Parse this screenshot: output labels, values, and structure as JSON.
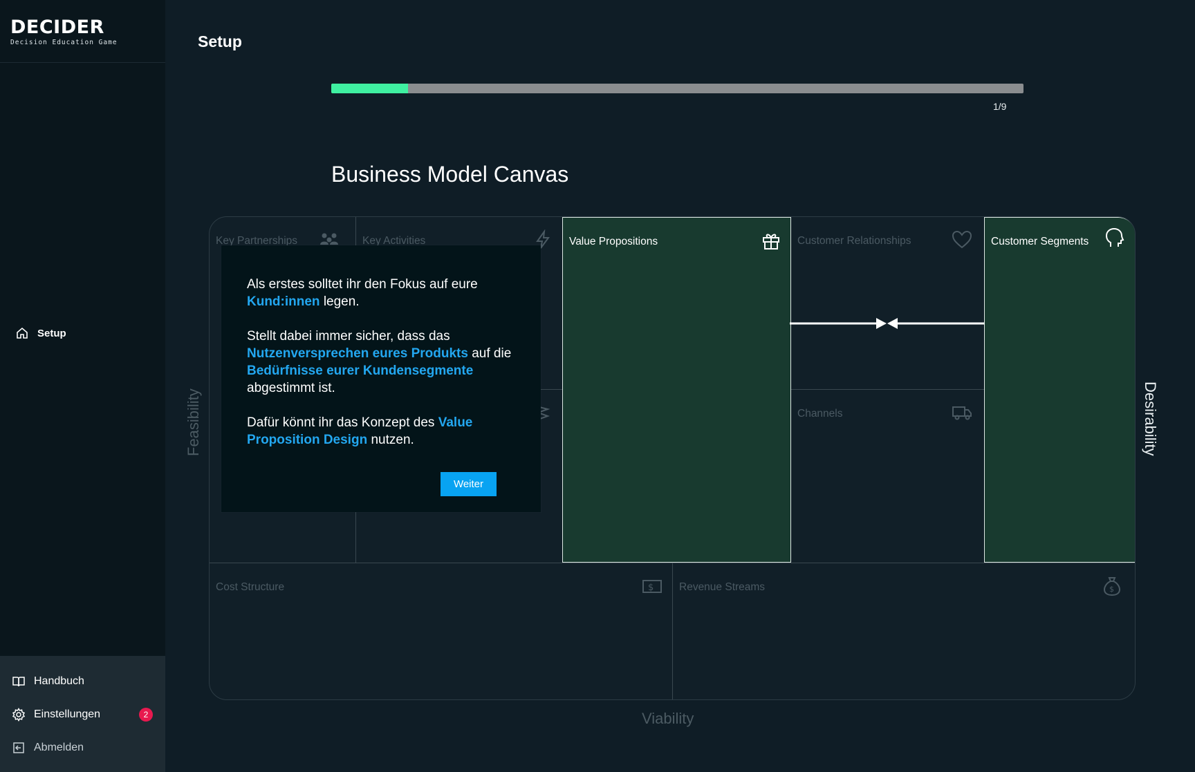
{
  "brand": {
    "name": "DECIDER",
    "subtitle": "Decision Education Game"
  },
  "sidebar": {
    "nav": [
      {
        "label": "Setup",
        "icon": "home-icon",
        "active": true
      }
    ],
    "bottom": [
      {
        "label": "Handbuch",
        "icon": "book-icon"
      },
      {
        "label": "Einstellungen",
        "icon": "gear-icon",
        "badge": "2"
      },
      {
        "label": "Abmelden",
        "icon": "logout-icon"
      }
    ]
  },
  "header": {
    "title": "Setup"
  },
  "progress": {
    "current": 1,
    "total": 9,
    "label": "1/9",
    "fraction": 0.111
  },
  "canvas": {
    "title": "Business Model Canvas",
    "cells": {
      "key_partnerships": "Key Partnerships",
      "key_activities": "Key Activities",
      "value_propositions": "Value Propositions",
      "customer_relationships": "Customer Relationships",
      "customer_segments": "Customer Segments",
      "channels": "Channels",
      "cost_structure": "Cost Structure",
      "revenue_streams": "Revenue Streams"
    },
    "axes": {
      "feasibility": "Feasibility",
      "desirability": "Desirability",
      "viability": "Viability"
    }
  },
  "modal": {
    "p1_a": "Als erstes solltet ihr den Fokus auf eure",
    "p1_hl": "Kund:innen",
    "p1_b": "legen.",
    "p2_a": "Stellt dabei immer sicher, dass das",
    "p2_hl1": "Nutzenversprechen eures Produkts",
    "p2_b": "auf die",
    "p2_hl2": "Bedürfnisse eurer Kundensegmente",
    "p2_c": "abgestimmt ist.",
    "p3_a": "Dafür könnt ihr das Konzept des",
    "p3_hl": "Value Proposition Design",
    "p3_b": "nutzen.",
    "button": "Weiter"
  },
  "colors": {
    "accent_green": "#3ff0a1",
    "accent_blue": "#08a3f2",
    "highlight_cell": "#183a2f",
    "badge": "#e8194f"
  }
}
